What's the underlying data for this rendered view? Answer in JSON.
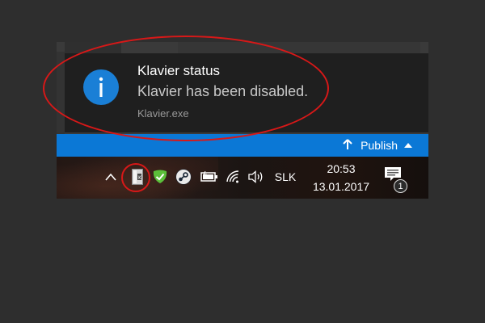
{
  "notification": {
    "title": "Klavier status",
    "message": "Klavier has been disabled.",
    "source": "Klavier.exe",
    "icon": "info-icon",
    "icon_color": "#1a7fd6"
  },
  "publish_bar": {
    "label": "Publish",
    "color": "#0b78d6"
  },
  "taskbar": {
    "tray_icons": [
      "chevron-up-icon",
      "klavier-icon",
      "shield-check-icon",
      "steam-icon",
      "battery-icon",
      "wifi-icon",
      "volume-icon"
    ],
    "language": "SLK",
    "time": "20:53",
    "date": "13.01.2017",
    "notification_count": "1"
  },
  "highlight_color": "#d81818"
}
